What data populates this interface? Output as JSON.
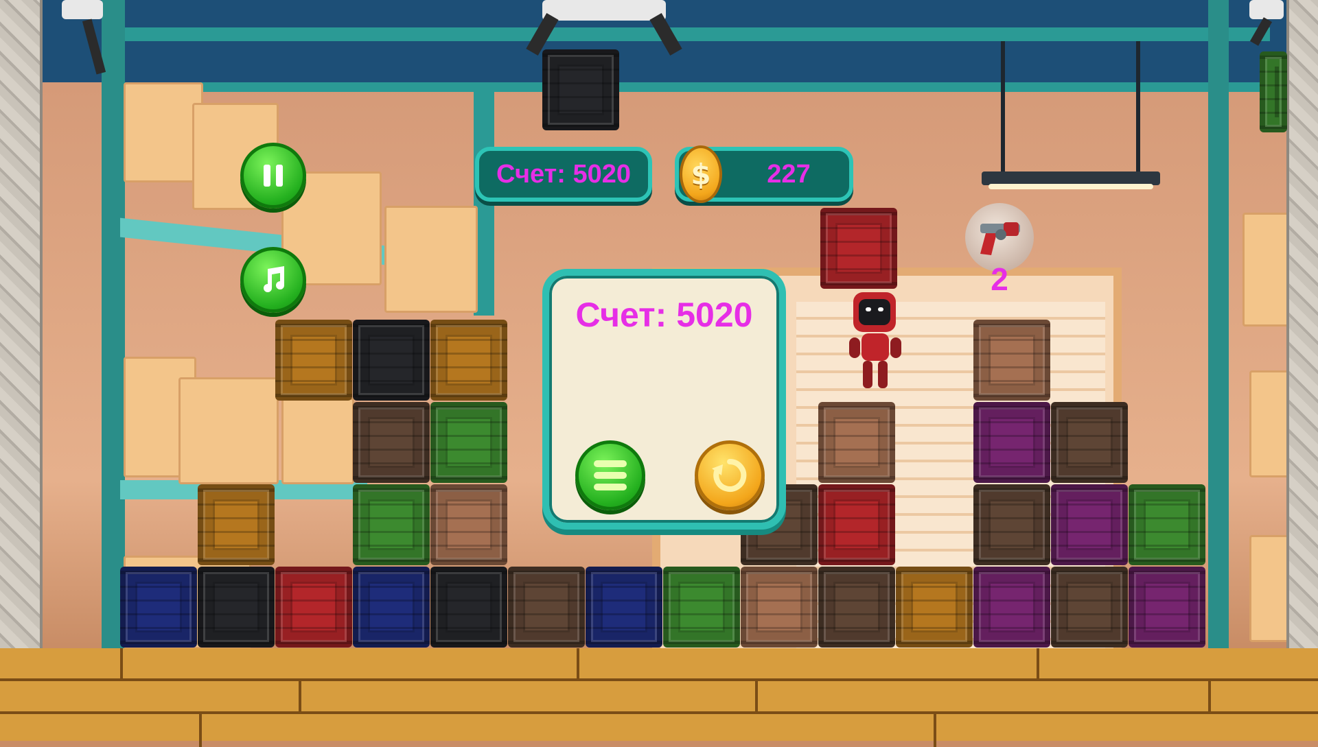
{
  "hud": {
    "score_label": "Счет: 5020",
    "coins": "227",
    "coin_symbol": "$",
    "weapon_ammo": "2"
  },
  "buttons": {
    "pause_icon": "pause-icon",
    "music_icon": "music-note-icon",
    "menu_icon": "menu-icon",
    "restart_icon": "restart-icon"
  },
  "dialog": {
    "score_label": "Счет: 5020"
  },
  "colors": {
    "hud_text": "#e62ee6",
    "hud_panel": "#0e6b62",
    "hud_border": "#2dc4b6",
    "button_green": "#24b01f",
    "button_gold": "#f3a61b"
  }
}
